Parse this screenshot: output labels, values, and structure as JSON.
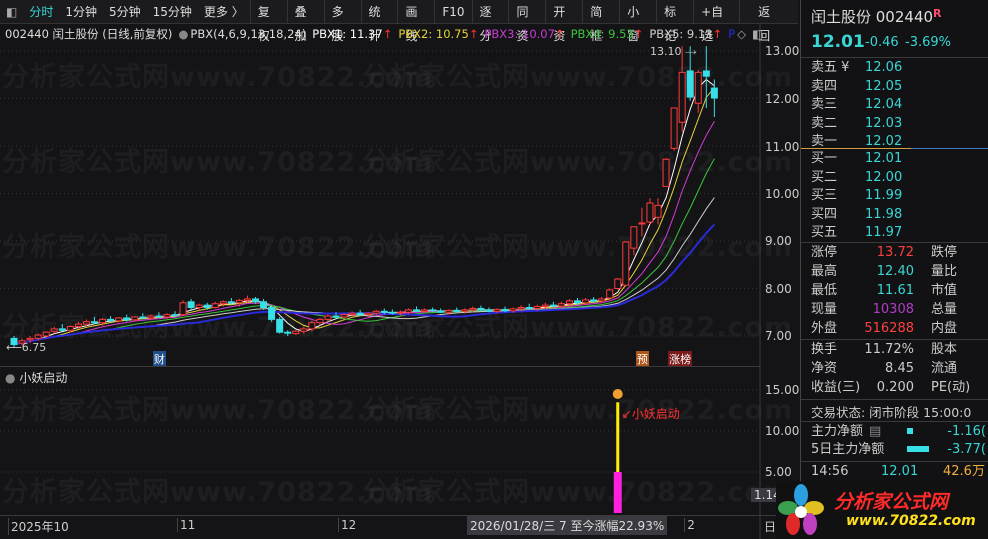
{
  "toolbar": {
    "periods": [
      "分时",
      "1分钟",
      "5分钟",
      "15分钟",
      "更多 〉"
    ],
    "buttons": [
      "复权",
      "叠加",
      "多股",
      "统计",
      "画线",
      "F10",
      "逐分",
      "同资",
      "开资",
      "简框",
      "小窗",
      "标记",
      "+自选",
      "返回"
    ]
  },
  "infobar": {
    "title": "002440 闰土股份 (日线,前复权)",
    "indicator": "PBX(4,6,9,13,18,24)",
    "lines": [
      {
        "label": "PBX1: 11.37",
        "color": "#ffffff"
      },
      {
        "label": "PBX2: 10.75",
        "color": "#e6d23a"
      },
      {
        "label": "PBX3: 10.07",
        "color": "#d43cd4"
      },
      {
        "label": "PBX4: 9.53",
        "color": "#3cc43c"
      },
      {
        "label": "PBX5: 9.13",
        "color": "#cfcfcf"
      }
    ],
    "arrow": "↑",
    "p_label": "P"
  },
  "watermark": "分析家公式网www.70822.com",
  "chart_data": {
    "type": "candlestick",
    "price_axis": [
      "13.00",
      "12.00",
      "11.00",
      "10.00",
      "9.00",
      "8.00",
      "7.00"
    ],
    "ylim": [
      6.6,
      13.3
    ],
    "high_label": "13.10",
    "low_label": "6.75",
    "ma_periods": [
      4,
      6,
      9,
      13,
      18,
      24
    ],
    "ma_colors": [
      "#ffffff",
      "#e6d23a",
      "#d43cd4",
      "#3cc43c",
      "#cfcfcf",
      "#2a2ad8"
    ],
    "up_color": "#ff3b3b",
    "down_color": "#36e0e6",
    "ohlc": [
      [
        6.95,
        7.0,
        6.75,
        6.82
      ],
      [
        6.85,
        6.95,
        6.8,
        6.9
      ],
      [
        6.92,
        7.0,
        6.85,
        6.95
      ],
      [
        6.95,
        7.05,
        6.9,
        7.02
      ],
      [
        7.0,
        7.1,
        6.95,
        7.08
      ],
      [
        7.1,
        7.2,
        7.05,
        7.15
      ],
      [
        7.15,
        7.25,
        7.1,
        7.12
      ],
      [
        7.12,
        7.22,
        7.08,
        7.2
      ],
      [
        7.2,
        7.3,
        7.15,
        7.25
      ],
      [
        7.25,
        7.35,
        7.2,
        7.3
      ],
      [
        7.3,
        7.4,
        7.25,
        7.28
      ],
      [
        7.28,
        7.38,
        7.22,
        7.35
      ],
      [
        7.35,
        7.42,
        7.3,
        7.32
      ],
      [
        7.32,
        7.4,
        7.28,
        7.38
      ],
      [
        7.38,
        7.45,
        7.3,
        7.34
      ],
      [
        7.34,
        7.42,
        7.3,
        7.4
      ],
      [
        7.4,
        7.48,
        7.35,
        7.38
      ],
      [
        7.38,
        7.45,
        7.33,
        7.42
      ],
      [
        7.42,
        7.5,
        7.38,
        7.4
      ],
      [
        7.4,
        7.48,
        7.36,
        7.45
      ],
      [
        7.45,
        7.52,
        7.4,
        7.43
      ],
      [
        7.45,
        7.75,
        7.42,
        7.7
      ],
      [
        7.72,
        7.78,
        7.55,
        7.6
      ],
      [
        7.6,
        7.68,
        7.52,
        7.65
      ],
      [
        7.65,
        7.7,
        7.55,
        7.6
      ],
      [
        7.6,
        7.72,
        7.58,
        7.68
      ],
      [
        7.68,
        7.75,
        7.62,
        7.72
      ],
      [
        7.72,
        7.8,
        7.66,
        7.7
      ],
      [
        7.7,
        7.78,
        7.62,
        7.75
      ],
      [
        7.75,
        7.85,
        7.7,
        7.78
      ],
      [
        7.78,
        7.82,
        7.68,
        7.72
      ],
      [
        7.72,
        7.78,
        7.55,
        7.6
      ],
      [
        7.6,
        7.65,
        7.3,
        7.35
      ],
      [
        7.35,
        7.4,
        7.05,
        7.08
      ],
      [
        7.08,
        7.12,
        7.0,
        7.06
      ],
      [
        7.05,
        7.12,
        7.02,
        7.1
      ],
      [
        7.1,
        7.2,
        7.05,
        7.15
      ],
      [
        7.15,
        7.32,
        7.1,
        7.28
      ],
      [
        7.28,
        7.38,
        7.22,
        7.35
      ],
      [
        7.35,
        7.45,
        7.3,
        7.42
      ],
      [
        7.42,
        7.5,
        7.36,
        7.4
      ],
      [
        7.4,
        7.48,
        7.35,
        7.45
      ],
      [
        7.45,
        7.52,
        7.4,
        7.48
      ],
      [
        7.48,
        7.55,
        7.42,
        7.45
      ],
      [
        7.45,
        7.5,
        7.4,
        7.48
      ],
      [
        7.48,
        7.55,
        7.44,
        7.52
      ],
      [
        7.52,
        7.58,
        7.46,
        7.5
      ],
      [
        7.5,
        7.56,
        7.45,
        7.48
      ],
      [
        7.48,
        7.54,
        7.42,
        7.5
      ],
      [
        7.5,
        7.58,
        7.46,
        7.55
      ],
      [
        7.55,
        7.62,
        7.5,
        7.52
      ],
      [
        7.52,
        7.58,
        7.48,
        7.55
      ],
      [
        7.55,
        7.6,
        7.5,
        7.53
      ],
      [
        7.53,
        7.58,
        7.48,
        7.5
      ],
      [
        7.5,
        7.56,
        7.45,
        7.54
      ],
      [
        7.54,
        7.6,
        7.5,
        7.52
      ],
      [
        7.52,
        7.58,
        7.47,
        7.55
      ],
      [
        7.55,
        7.62,
        7.5,
        7.58
      ],
      [
        7.58,
        7.64,
        7.52,
        7.55
      ],
      [
        7.55,
        7.6,
        7.5,
        7.52
      ],
      [
        7.52,
        7.58,
        7.48,
        7.56
      ],
      [
        7.56,
        7.62,
        7.5,
        7.53
      ],
      [
        7.53,
        7.6,
        7.49,
        7.57
      ],
      [
        7.57,
        7.65,
        7.52,
        7.6
      ],
      [
        7.6,
        7.68,
        7.55,
        7.58
      ],
      [
        7.58,
        7.66,
        7.53,
        7.62
      ],
      [
        7.62,
        7.7,
        7.56,
        7.65
      ],
      [
        7.65,
        7.72,
        7.6,
        7.63
      ],
      [
        7.63,
        7.72,
        7.58,
        7.68
      ],
      [
        7.68,
        7.78,
        7.62,
        7.74
      ],
      [
        7.74,
        7.8,
        7.66,
        7.7
      ],
      [
        7.7,
        7.8,
        7.65,
        7.76
      ],
      [
        7.76,
        7.82,
        7.7,
        7.74
      ],
      [
        7.74,
        7.82,
        7.7,
        7.78
      ],
      [
        7.8,
        8.0,
        7.78,
        7.97
      ],
      [
        8.0,
        8.22,
        7.98,
        8.2
      ],
      [
        8.07,
        9.0,
        8.05,
        8.98
      ],
      [
        8.85,
        9.3,
        8.7,
        9.3
      ],
      [
        9.38,
        9.7,
        9.1,
        9.38
      ],
      [
        9.4,
        9.9,
        9.35,
        9.8
      ],
      [
        9.5,
        9.9,
        9.35,
        9.75
      ],
      [
        10.15,
        10.75,
        10.15,
        10.72
      ],
      [
        10.95,
        11.8,
        10.9,
        11.8
      ],
      [
        11.5,
        13.1,
        11.3,
        12.55
      ],
      [
        12.58,
        13.1,
        11.95,
        12.03
      ],
      [
        11.9,
        12.6,
        11.7,
        12.55
      ],
      [
        12.58,
        13.1,
        11.8,
        12.47
      ],
      [
        12.22,
        12.4,
        11.61,
        12.01
      ]
    ],
    "markers": [
      {
        "index": 18,
        "label": "财",
        "color": "#1f4f8a"
      },
      {
        "index": 78,
        "label": "预",
        "color": "#b0561a"
      },
      {
        "index": 82,
        "label": "涨榜",
        "color": "#7a1a1a"
      }
    ]
  },
  "sub_chart": {
    "title": "小妖启动",
    "axis": [
      "15.00",
      "10.00",
      "5.00"
    ],
    "current_label": "1.14",
    "signal_index": 75,
    "signal_label": "↙小妖启动",
    "bar_base": 5,
    "bar_top": 13.5,
    "marker_value": 15
  },
  "time_axis": {
    "labels": [
      {
        "index": 0,
        "text": "2025年10"
      },
      {
        "index": 21,
        "text": "11"
      },
      {
        "index": 41,
        "text": "12"
      },
      {
        "index": 84,
        "text": "2"
      }
    ],
    "cursor_text": "2026/01/28/三 7 至今涨幅22.93%",
    "period": "日线"
  },
  "quote": {
    "name": "闰土股份 002440",
    "badge": "R",
    "price": "12.01",
    "change": "-0.46",
    "pct": "-3.69%",
    "asks": [
      {
        "l": "卖五 ¥",
        "v": "12.06"
      },
      {
        "l": "卖四",
        "v": "12.05"
      },
      {
        "l": "卖三",
        "v": "12.04"
      },
      {
        "l": "卖二",
        "v": "12.03"
      },
      {
        "l": "卖一",
        "v": "12.02"
      }
    ],
    "bids": [
      {
        "l": "买一",
        "v": "12.01"
      },
      {
        "l": "买二",
        "v": "12.00"
      },
      {
        "l": "买三",
        "v": "11.99"
      },
      {
        "l": "买四",
        "v": "11.98"
      },
      {
        "l": "买五",
        "v": "11.97"
      }
    ],
    "stats": [
      {
        "l": "涨停",
        "v": "13.72",
        "c": "#ff4040",
        "l2": "跌停"
      },
      {
        "l": "最高",
        "v": "12.40",
        "c": "#3ad6d6",
        "l2": "量比"
      },
      {
        "l": "最低",
        "v": "11.61",
        "c": "#3ad6d6",
        "l2": "市值"
      },
      {
        "l": "现量",
        "v": "10308",
        "c": "#b03cc8",
        "l2": "总量"
      },
      {
        "l": "外盘",
        "v": "516288",
        "c": "#ff4040",
        "l2": "内盘"
      }
    ],
    "stats2": [
      {
        "l": "换手",
        "v": "11.72%",
        "l2": "股本"
      },
      {
        "l": "净资",
        "v": "8.45",
        "l2": "流通"
      },
      {
        "l": "收益(三)",
        "v": "0.200",
        "l2": "PE(动)"
      }
    ],
    "status": "交易状态: 闭市阶段 15:00:0",
    "flows": [
      {
        "l": "主力净额",
        "v": "-1.16("
      },
      {
        "l": "5日主力净额",
        "v": "-3.77("
      }
    ],
    "tick": {
      "time": "14:56",
      "price": "12.01",
      "vol": "42.6万"
    }
  },
  "logo": {
    "name": "分析家公式网",
    "url": "www.70822.com"
  }
}
